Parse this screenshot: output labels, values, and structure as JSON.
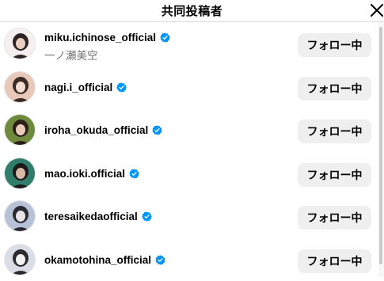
{
  "header": {
    "title": "共同投稿者",
    "close_icon": "close-icon"
  },
  "accounts": [
    {
      "username": "miku.ichinose_official",
      "full_name": "一ノ瀬美空",
      "verified": true,
      "follow_label": "フォロー中",
      "avatar_colors": [
        "#f5f0ef",
        "#2b2423",
        "#e9cfc2"
      ]
    },
    {
      "username": "nagi.i_official",
      "full_name": "",
      "verified": true,
      "follow_label": "フォロー中",
      "avatar_colors": [
        "#e8c8b8",
        "#3a2a24",
        "#f3ddd2"
      ]
    },
    {
      "username": "iroha_okuda_official",
      "full_name": "",
      "verified": true,
      "follow_label": "フォロー中",
      "avatar_colors": [
        "#6f8a3c",
        "#2a2018",
        "#e8cbb8"
      ]
    },
    {
      "username": "mao.ioki.official",
      "full_name": "",
      "verified": true,
      "follow_label": "フォロー中",
      "avatar_colors": [
        "#2f7d6a",
        "#1c1a1a",
        "#d9b9a8"
      ]
    },
    {
      "username": "teresaikedaofficial",
      "full_name": "",
      "verified": true,
      "follow_label": "フォロー中",
      "avatar_colors": [
        "#b8c2d6",
        "#2a2830",
        "#e7e3e8"
      ]
    },
    {
      "username": "okamotohina_official",
      "full_name": "",
      "verified": true,
      "follow_label": "フォロー中",
      "avatar_colors": [
        "#d9dde6",
        "#2c2a2e",
        "#f1f0f2"
      ]
    }
  ],
  "colors": {
    "verified_blue": "#0095f6",
    "button_bg": "#efefef",
    "secondary_text": "#737373"
  }
}
